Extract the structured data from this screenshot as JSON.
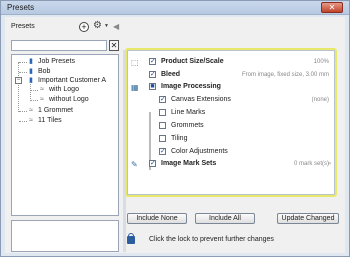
{
  "window": {
    "title": "Presets"
  },
  "left": {
    "label": "Presets",
    "tree": [
      {
        "label": "Job Presets"
      },
      {
        "label": "Bob"
      },
      {
        "label": "Important Customer A"
      },
      {
        "label": "with Logo"
      },
      {
        "label": "without Logo"
      },
      {
        "label": "1 Grommet"
      },
      {
        "label": "11 Tiles"
      }
    ]
  },
  "panel": {
    "rows": [
      {
        "label": "Product Size/Scale",
        "value": "100%"
      },
      {
        "label": "Bleed",
        "value": "From image, fixed size, 3.00 mm"
      },
      {
        "label": "Image Processing",
        "value": ""
      },
      {
        "label": "Canvas Extensions",
        "value": "(none)"
      },
      {
        "label": "Line Marks",
        "value": ""
      },
      {
        "label": "Grommets",
        "value": ""
      },
      {
        "label": "Tiling",
        "value": ""
      },
      {
        "label": "Color Adjustments",
        "value": ""
      },
      {
        "label": "Image Mark Sets",
        "value": "0 mark set(s)"
      }
    ],
    "checks": [
      "✓",
      "✓",
      "■",
      "✓",
      "",
      "",
      "",
      "✓",
      "✓"
    ]
  },
  "buttons": {
    "include_none": "Include None",
    "include_all": "Include All",
    "update_changed": "Update Changed"
  },
  "lock_text": "Click the lock to prevent further changes"
}
